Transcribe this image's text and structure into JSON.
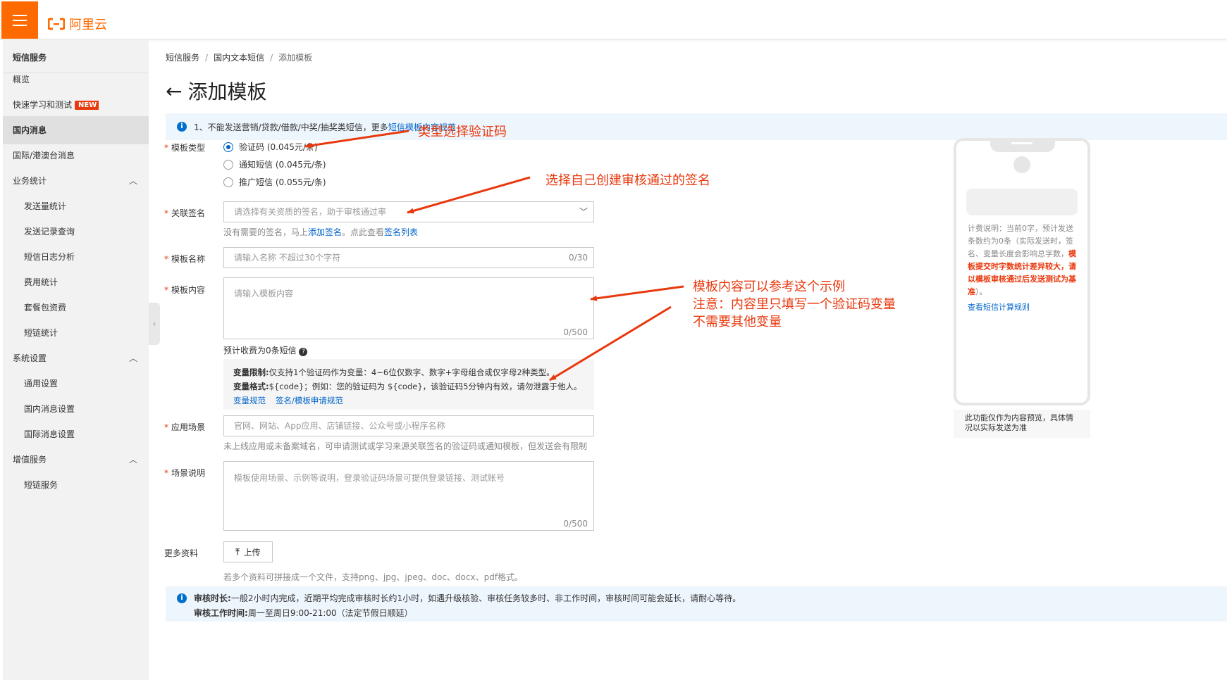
{
  "topbar": {
    "brand": "阿里云"
  },
  "sidebar": {
    "title": "短信服务",
    "items": [
      {
        "label": "概览"
      },
      {
        "label": "快速学习和测试",
        "badge": "NEW"
      },
      {
        "label": "国内消息"
      },
      {
        "label": "国际/港澳台消息"
      },
      {
        "label": "业务统计"
      },
      {
        "label": "发送量统计"
      },
      {
        "label": "发送记录查询"
      },
      {
        "label": "短信日志分析"
      },
      {
        "label": "费用统计"
      },
      {
        "label": "套餐包资费"
      },
      {
        "label": "短链统计"
      },
      {
        "label": "系统设置"
      },
      {
        "label": "通用设置"
      },
      {
        "label": "国内消息设置"
      },
      {
        "label": "国际消息设置"
      },
      {
        "label": "增值服务"
      },
      {
        "label": "短链服务"
      }
    ]
  },
  "breadcrumb": {
    "items": [
      "短信服务",
      "国内文本短信",
      "添加模板"
    ]
  },
  "page": {
    "title": "添加模板"
  },
  "notice": {
    "text": "1、不能发送营销/贷款/借款/中奖/抽奖类短信，更多",
    "link": "短信模板内容规范"
  },
  "form": {
    "type_label": "模板类型",
    "type_options": [
      "验证码 (0.045元/条)",
      "通知短信 (0.045元/条)",
      "推广短信 (0.055元/条)"
    ],
    "sign_label": "关联签名",
    "sign_placeholder": "请选择有关资质的签名，助于审核通过率",
    "sign_hint_pre": "没有需要的签名，马上",
    "sign_hint_link1": "添加签名",
    "sign_hint_mid": "。点此查看",
    "sign_hint_link2": "签名列表",
    "name_label": "模板名称",
    "name_placeholder": "请输入名称 不超过30个字符",
    "name_count": "0/30",
    "content_label": "模板内容",
    "content_placeholder": "请输入模板内容",
    "content_count": "0/500",
    "fee_estimate": "预计收费为0条短信",
    "var_limit_label": "变量限制:",
    "var_limit_text": "仅支持1个验证码作为变量：4~6位仅数字、数字+字母组合或仅字母2种类型。",
    "var_format_label": "变量格式:",
    "var_format_text": "${code}；例如：您的验证码为 ${code}，该验证码5分钟内有效，请勿泄露于他人。",
    "var_link1": "变量规范",
    "var_link2": "签名/模板申请规范",
    "scene_label": "应用场景",
    "scene_placeholder": "官网、网站、App应用、店铺链接、公众号或小程序名称",
    "scene_hint": "未上线应用或未备案域名，可申请测试或学习来源关联签名的验证码或通知模板，但发送会有限制",
    "desc_label": "场景说明",
    "desc_placeholder": "模板使用场景、示例等说明，登录验证码场景可提供登录链接、测试账号",
    "desc_count": "0/500",
    "more_label": "更多资料",
    "upload_label": "上传",
    "upload_hint": "若多个资料可拼接成一个文件，支持png、jpg、jpeg、doc、docx、pdf格式。"
  },
  "bottom_notice": {
    "l1_label": "审核时长:",
    "l1_text": "一般2小时内完成，近期平均完成审核时长约1小时，如遇升级核验、审核任务较多时、非工作时间，审核时间可能会延长，请耐心等待。",
    "l2_label": "审核工作时间:",
    "l2_text": "周一至周日9:00-21:00（法定节假日顺延）"
  },
  "preview": {
    "desc_normal": "计费说明：当前0字，预计发送条数约为0条（实际发送时，签名、变量长度会影响总字数，",
    "desc_red": "模板提交时字数统计差异较大，请以模板审核通过后发送测试为基准",
    "desc_end": "）。",
    "link": "查看短信计算规则",
    "note": "此功能仅作为内容预览，具体情况以实际发送为准"
  },
  "annotations": {
    "a1": "类型选择验证码",
    "a2": "选择自己创建审核通过的签名",
    "a3_l1": "模板内容可以参考这个示例",
    "a3_l2": "注意：内容里只填写一个验证码变量",
    "a3_l3": "不需要其他变量"
  },
  "colors": {
    "brand": "#ff6a00",
    "link": "#0064c8",
    "annotation": "#e8380d"
  }
}
